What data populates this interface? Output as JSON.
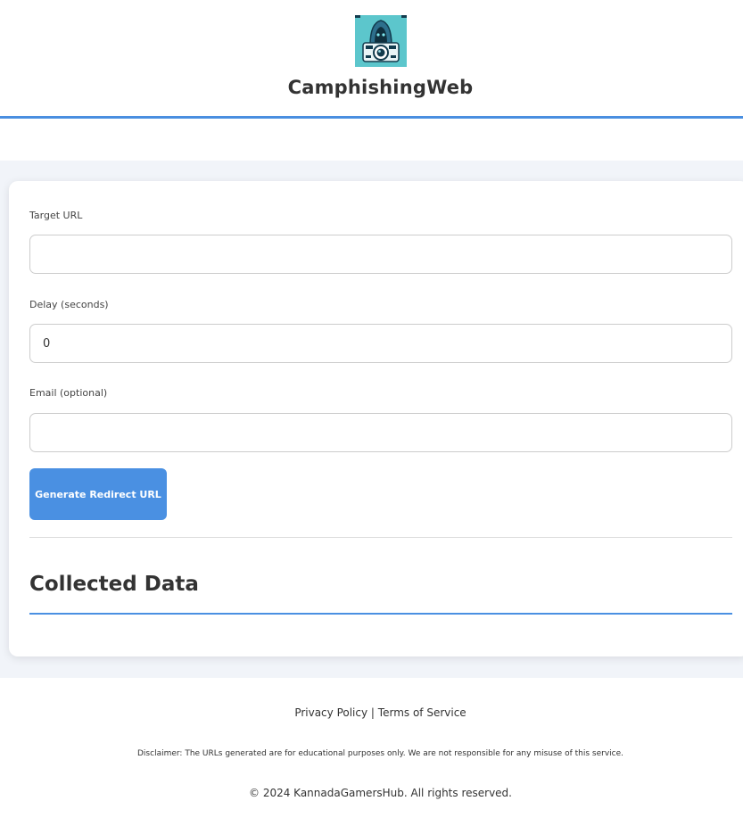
{
  "header": {
    "logo_icon": "hooded-hacker-camera-icon",
    "site_title": "CamphishingWeb",
    "accent_color": "#4a90e2"
  },
  "form": {
    "target_url": {
      "label": "Target URL",
      "value": ""
    },
    "delay": {
      "label": "Delay (seconds)",
      "value": "0"
    },
    "email": {
      "label": "Email (optional)",
      "value": ""
    },
    "generate_button_label": "Generate Redirect URL"
  },
  "collected": {
    "title": "Collected Data"
  },
  "footer": {
    "privacy_label": "Privacy Policy",
    "separator": "|",
    "terms_label": "Terms of Service",
    "disclaimer": "Disclaimer: The URLs generated are for educational purposes only. We are not responsible for any misuse of this service.",
    "copyright": "© 2024 KannadaGamersHub. All rights reserved."
  }
}
